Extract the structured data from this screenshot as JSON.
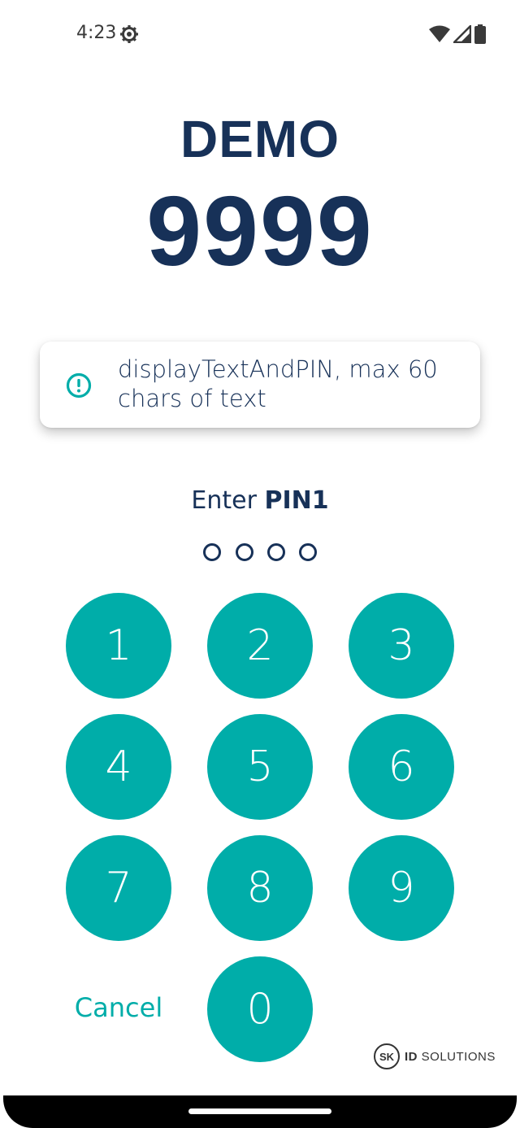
{
  "status_bar": {
    "time": "4:23",
    "icons": [
      "settings-gear-icon",
      "wifi-icon",
      "cell-signal-icon",
      "battery-icon"
    ]
  },
  "header": {
    "title": "DEMO",
    "code": "9999"
  },
  "info_card": {
    "icon": "info-circle-icon",
    "text": "displayTextAndPIN, max 60 chars of text"
  },
  "pin_entry": {
    "prompt_prefix": "Enter ",
    "prompt_pin": "PIN1",
    "dots_count": 4,
    "entered": 0
  },
  "keypad": {
    "keys": [
      "1",
      "2",
      "3",
      "4",
      "5",
      "6",
      "7",
      "8",
      "9",
      "0"
    ],
    "cancel_label": "Cancel"
  },
  "footer": {
    "logo_mark": "SK",
    "logo_bold": "ID",
    "logo_text": "SOLUTIONS"
  },
  "colors": {
    "primary": "#00ada9",
    "navy": "#173158",
    "background": "#ffffff"
  }
}
